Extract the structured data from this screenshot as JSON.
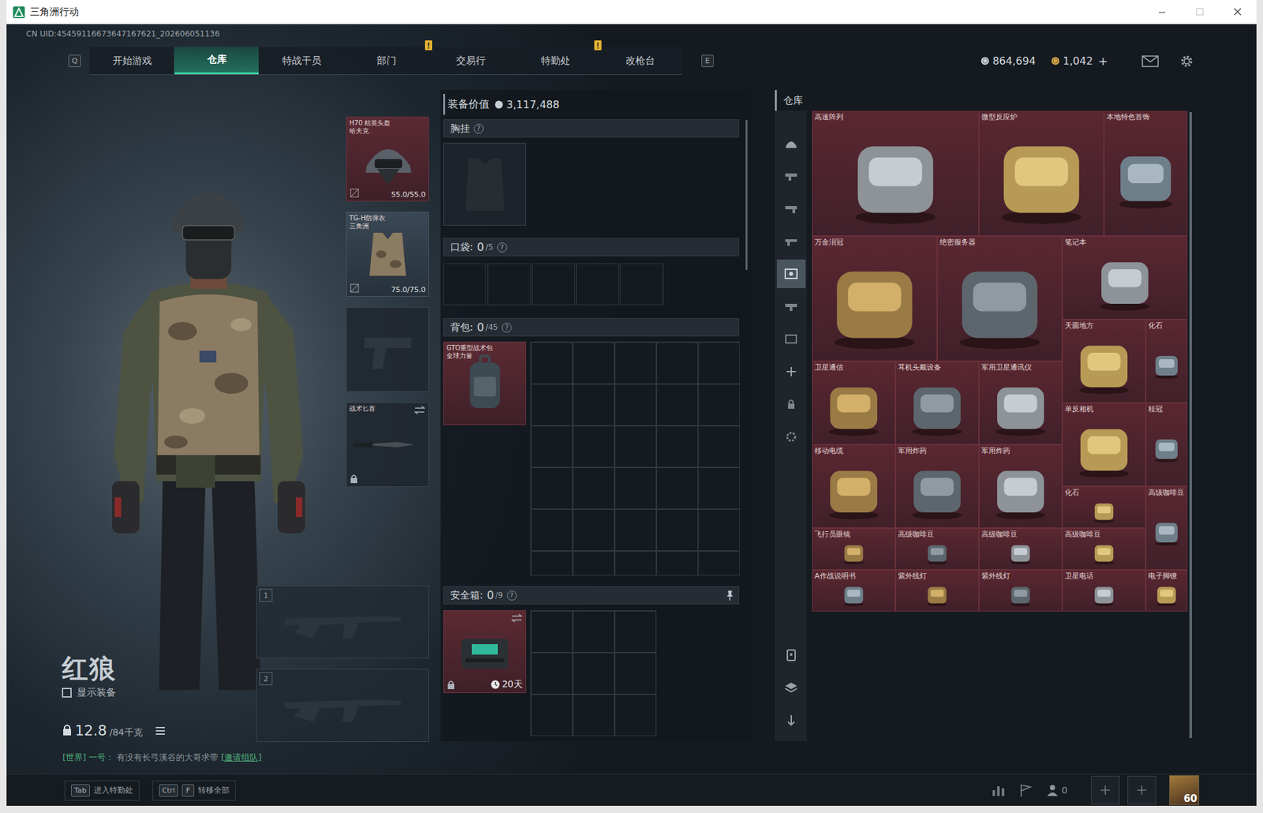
{
  "window": {
    "title": "三角洲行动"
  },
  "uid": "CN UID:45459116673647167621_202606051136",
  "nav": {
    "prev_key": "Q",
    "next_key": "E",
    "tabs": [
      {
        "label": "开始游戏",
        "selected": false,
        "badge": false
      },
      {
        "label": "仓库",
        "selected": true,
        "badge": false
      },
      {
        "label": "特战干员",
        "selected": false,
        "badge": false
      },
      {
        "label": "部门",
        "selected": false,
        "badge": true
      },
      {
        "label": "交易行",
        "selected": false,
        "badge": false
      },
      {
        "label": "特勤处",
        "selected": false,
        "badge": true
      },
      {
        "label": "改枪台",
        "selected": false,
        "badge": false
      }
    ]
  },
  "currency": [
    {
      "amount": "864,694",
      "color": "#c9ced4"
    },
    {
      "amount": "1,042",
      "color": "#d9a441"
    }
  ],
  "currency_add": "+",
  "operator": {
    "name": "红狼",
    "show_gear": {
      "label": "显示装备",
      "checked": false
    },
    "weight": "12.8",
    "capacity": "/84千克"
  },
  "equipment": {
    "helmet": {
      "name": "H70 精英头盔",
      "sub": "哈夫克",
      "durability": "55.0/55.0"
    },
    "armor": {
      "name": "TG-H防弹衣",
      "sub": "三角洲",
      "durability": "75.0/75.0"
    },
    "melee": {
      "name": "战术匕首",
      "locked": true
    },
    "weapon_slots": [
      "1",
      "2"
    ]
  },
  "loadout": {
    "value_label": "装备价值",
    "value": "3,117,488",
    "chest": {
      "label": "胸挂",
      "help": "?"
    },
    "pocket": {
      "label": "口袋:",
      "used": "0",
      "cap": "/5",
      "help": "?"
    },
    "backpack": {
      "label": "背包:",
      "used": "0",
      "cap": "/45",
      "help": "?",
      "item": "GTO重型战术包",
      "item_sub": "全球力量"
    },
    "safe": {
      "label": "安全箱:",
      "used": "0",
      "cap": "/9",
      "help": "?",
      "timer": "20天",
      "locked": true
    }
  },
  "warehouse": {
    "title": "仓库",
    "sidebar": [
      {
        "selected": false
      },
      {
        "selected": false
      },
      {
        "selected": false
      },
      {
        "selected": false
      },
      {
        "selected": true
      },
      {
        "selected": false
      },
      {
        "selected": false
      },
      {
        "selected": false
      },
      {
        "selected": false
      },
      {
        "selected": false
      },
      {
        "selected": false
      },
      {
        "selected": false
      },
      {
        "selected": false
      }
    ],
    "items": [
      {
        "name": "高速阵列"
      },
      {
        "name": "微型反应炉"
      },
      {
        "name": "本地特色首饰"
      },
      {
        "name": "万金泪冠"
      },
      {
        "name": "绝密服务器"
      },
      {
        "name": "笔记本"
      },
      {
        "name": "天圆地方"
      },
      {
        "name": "化石"
      },
      {
        "name": "卫星通信"
      },
      {
        "name": "耳机头戴设备"
      },
      {
        "name": "军用卫星通讯仪"
      },
      {
        "name": "单反相机"
      },
      {
        "name": "桂冠"
      },
      {
        "name": "移动电缆"
      },
      {
        "name": "军用炸药"
      },
      {
        "name": "军用炸药"
      },
      {
        "name": "化石"
      },
      {
        "name": "高级咖啡豆"
      },
      {
        "name": "飞行员眼镜"
      },
      {
        "name": "高级咖啡豆"
      },
      {
        "name": "高级咖啡豆"
      },
      {
        "name": "高级咖啡豆"
      },
      {
        "name": "A作战说明书"
      },
      {
        "name": "紫外线灯"
      },
      {
        "name": "紫外线灯"
      },
      {
        "name": "卫星电话"
      },
      {
        "name": "电子脚镣"
      }
    ]
  },
  "chat": {
    "channel": "[世界]",
    "sender": "一号：",
    "message": "有没有长弓溪谷的大哥求带",
    "action": "[邀请组队]"
  },
  "bottom": {
    "hints": [
      {
        "keys": [
          "Tab"
        ],
        "label": "进入特勤处"
      },
      {
        "keys": [
          "Ctrl",
          "F"
        ],
        "label": "转移全部"
      }
    ],
    "friends": "0",
    "level": "60"
  }
}
